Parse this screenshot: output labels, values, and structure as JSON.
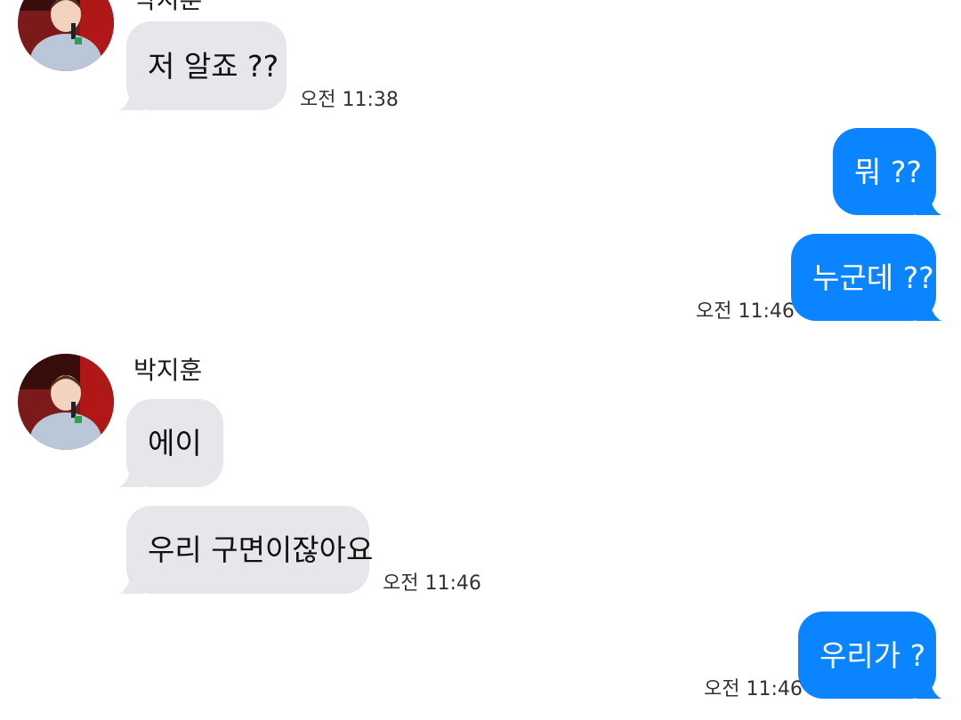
{
  "colors": {
    "incoming_bubble": "#e6e6eb",
    "outgoing_bubble": "#0a84ff",
    "background": "#ffffff"
  },
  "messages": [
    {
      "direction": "in",
      "sender": "박지훈",
      "text": "저 알죠 ??",
      "time": "오전 11:38",
      "avatar": "profile-photo"
    },
    {
      "direction": "out",
      "text": "뭐 ??"
    },
    {
      "direction": "out",
      "text": "누군데 ??",
      "time": "오전 11:46"
    },
    {
      "direction": "in",
      "sender": "박지훈",
      "text": "에이",
      "avatar": "profile-photo"
    },
    {
      "direction": "in",
      "text": "우리 구면이잖아요",
      "time": "오전 11:46"
    },
    {
      "direction": "out",
      "text": "우리가 ?",
      "time": "오전 11:46"
    }
  ]
}
